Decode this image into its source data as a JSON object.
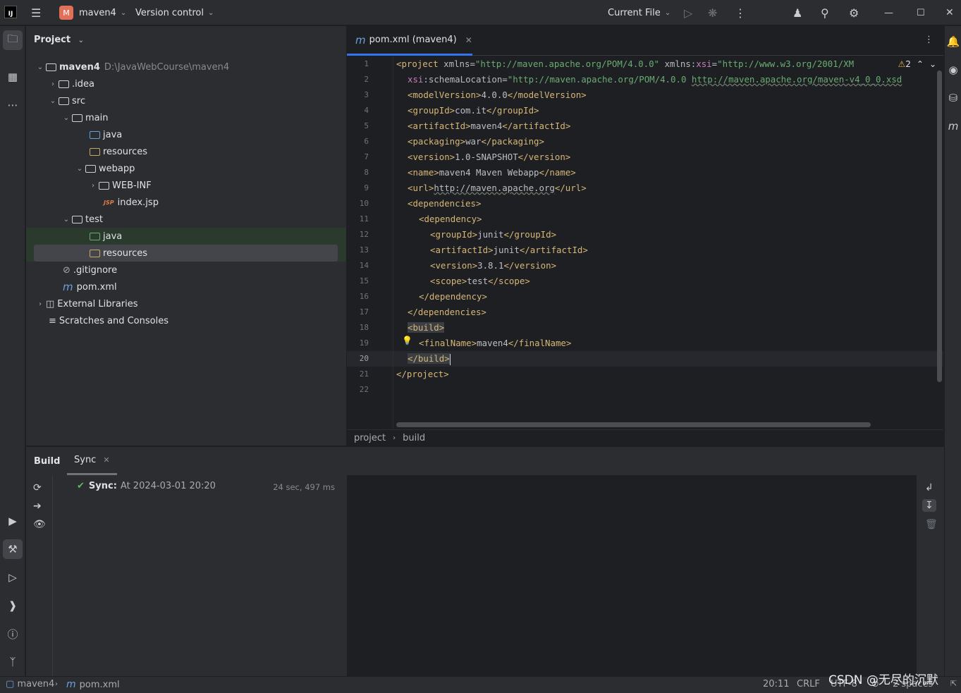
{
  "titlebar": {
    "logo_text": "IJ",
    "project_badge": "M",
    "project_name": "maven4",
    "vcs_label": "Version control",
    "run_config": "Current File"
  },
  "project_panel": {
    "header": "Project",
    "tree": [
      {
        "label": "maven4",
        "hint": "D:\\JavaWebCourse\\maven4"
      },
      {
        "label": ".idea"
      },
      {
        "label": "src"
      },
      {
        "label": "main"
      },
      {
        "label": "java"
      },
      {
        "label": "resources"
      },
      {
        "label": "webapp"
      },
      {
        "label": "WEB-INF"
      },
      {
        "label": "index.jsp"
      },
      {
        "label": "test"
      },
      {
        "label": "java"
      },
      {
        "label": "resources"
      },
      {
        "label": ".gitignore"
      },
      {
        "label": "pom.xml"
      },
      {
        "label": "External Libraries"
      },
      {
        "label": "Scratches and Consoles"
      }
    ]
  },
  "editor": {
    "tab_label": "pom.xml (maven4)",
    "warning_count": "2",
    "current_line": "20",
    "lines": [
      {
        "n": "1",
        "html_key": "l1"
      },
      {
        "n": "2"
      },
      {
        "n": "3"
      },
      {
        "n": "4"
      },
      {
        "n": "5"
      },
      {
        "n": "6"
      },
      {
        "n": "7"
      },
      {
        "n": "8"
      },
      {
        "n": "9"
      },
      {
        "n": "10"
      },
      {
        "n": "11"
      },
      {
        "n": "12"
      },
      {
        "n": "13"
      },
      {
        "n": "14"
      },
      {
        "n": "15"
      },
      {
        "n": "16"
      },
      {
        "n": "17"
      },
      {
        "n": "18"
      },
      {
        "n": "19"
      },
      {
        "n": "20"
      },
      {
        "n": "21"
      },
      {
        "n": "22"
      }
    ],
    "code": {
      "l1_tag": "<project",
      "l1_a1": " xmlns",
      "l1_v1": "\"http://maven.apache.org/POM/4.0.0\"",
      "l1_a2": " xmlns",
      "l1_ns2": "xsi",
      "l1_v2": "\"http://www.w3.org/2001/XM",
      "l2_ns": "xsi",
      "l2_a": ":schemaLocation",
      "l2_v1": "\"http://maven.apache.org/POM/4.0.0 ",
      "l2_v2": "http://maven.apache.org/maven-v4_0_0.xsd",
      "l3_open": "<modelVersion>",
      "l3_text": "4.0.0",
      "l3_close": "</modelVersion>",
      "l4_open": "<groupId>",
      "l4_text": "com.it",
      "l4_close": "</groupId>",
      "l5_open": "<artifactId>",
      "l5_text": "maven4",
      "l5_close": "</artifactId>",
      "l6_open": "<packaging>",
      "l6_text": "war",
      "l6_close": "</packaging>",
      "l7_open": "<version>",
      "l7_text": "1.0-SNAPSHOT",
      "l7_close": "</version>",
      "l8_open": "<name>",
      "l8_text": "maven4 Maven Webapp",
      "l8_close": "</name>",
      "l9_open": "<url>",
      "l9_text": "http://maven.apache.org",
      "l9_close": "</url>",
      "l10": "<dependencies>",
      "l11": "<dependency>",
      "l12_open": "<groupId>",
      "l12_text": "junit",
      "l12_close": "</groupId>",
      "l13_open": "<artifactId>",
      "l13_text": "junit",
      "l13_close": "</artifactId>",
      "l14_open": "<version>",
      "l14_text": "3.8.1",
      "l14_close": "</version>",
      "l15_open": "<scope>",
      "l15_text": "test",
      "l15_close": "</scope>",
      "l16": "</dependency>",
      "l17": "</dependencies>",
      "l18": "<build>",
      "l19_open": "<finalName>",
      "l19_text": "maven4",
      "l19_close": "</finalName>",
      "l20": "</build>",
      "l21": "</project>"
    },
    "breadcrumb": [
      "project",
      "build"
    ]
  },
  "build_panel": {
    "tab_build": "Build",
    "tab_sync": "Sync",
    "sync_label": "Sync:",
    "sync_detail": "At 2024-03-01 20:20",
    "sync_time": "24 sec, 497 ms"
  },
  "statusbar": {
    "crumb1": "maven4",
    "crumb2": "pom.xml",
    "position": "20:11",
    "line_sep": "CRLF",
    "encoding": "UTF-8",
    "indent": "2 spaces",
    "watermark": "CSDN @无尽的沉默"
  }
}
